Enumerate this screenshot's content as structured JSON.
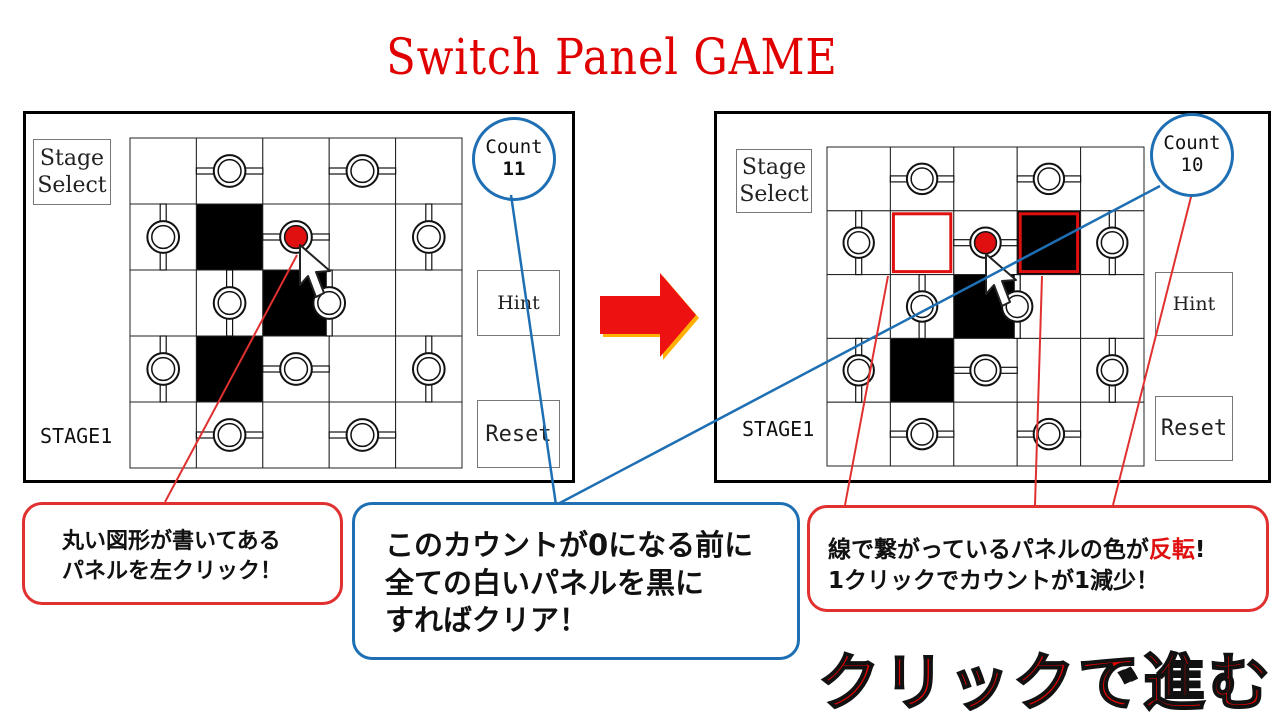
{
  "title": "Switch Panel GAME",
  "left_screen": {
    "stage_select": [
      "Stage",
      "Select"
    ],
    "count_label": "Count",
    "count_value": "11",
    "hint_label": "Hint",
    "reset_label": "Reset",
    "stage_label": "STAGE1",
    "black_cells": [
      [
        1,
        1
      ],
      [
        2,
        2
      ],
      [
        3,
        1
      ]
    ],
    "highlighted_cells": [],
    "selected_node": [
      1,
      2
    ]
  },
  "right_screen": {
    "stage_select": [
      "Stage",
      "Select"
    ],
    "count_label": "Count",
    "count_value": "10",
    "hint_label": "Hint",
    "reset_label": "Reset",
    "stage_label": "STAGE1",
    "black_cells": [
      [
        1,
        3
      ],
      [
        2,
        2
      ],
      [
        3,
        1
      ]
    ],
    "highlighted_cells": [
      [
        1,
        1
      ],
      [
        1,
        3
      ]
    ],
    "selected_node": [
      1,
      2
    ]
  },
  "notes": {
    "left": [
      "丸い図形が書いてある",
      "パネルを左クリック！"
    ],
    "center": [
      "このカウントが0になる前に",
      "全ての白いパネルを黒に",
      "すればクリア！"
    ],
    "right_line1_before": "線で繋がっているパネルの色が",
    "right_line1_emph": "反転",
    "right_line1_after": "!",
    "right_line2": "1クリックでカウントが1減少！"
  },
  "advance_label": "クリックで進む",
  "colors": {
    "title": "#e00000",
    "accent_red": "#e01010",
    "accent_blue": "#1e6fb3",
    "arrow": "#ee1111",
    "arrow_shadow": "#ffb000"
  }
}
